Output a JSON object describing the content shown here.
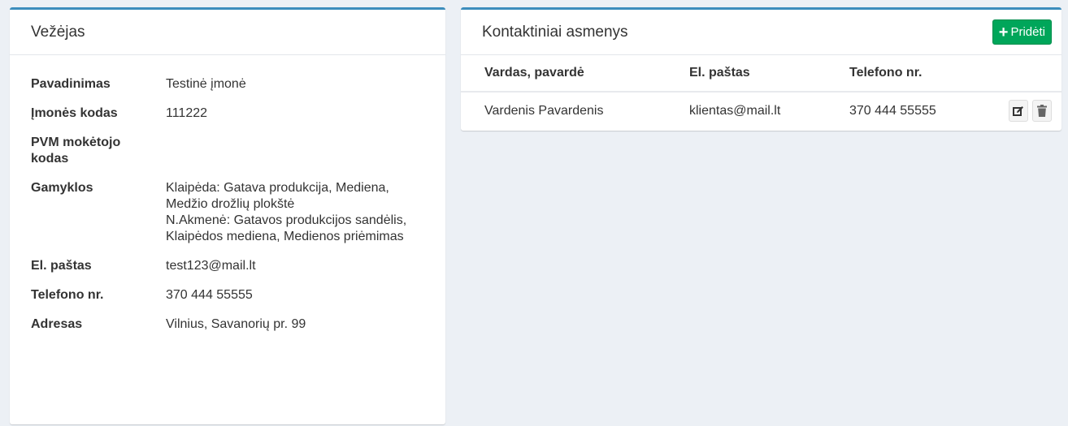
{
  "carrier": {
    "title": "Vežėjas",
    "fields": {
      "name_label": "Pavadinimas",
      "name_value": "Testinė įmonė",
      "code_label": "Įmonės kodas",
      "code_value": "111222",
      "vat_label": "PVM mokėtojo kodas",
      "vat_value": "",
      "factories_label": "Gamyklos",
      "factories_line1": "Klaipėda: Gatava produkcija, Mediena, Medžio drožlių plokštė",
      "factories_line2": "N.Akmenė: Gatavos produkcijos sandėlis, Klaipėdos mediena, Medienos priėmimas",
      "email_label": "El. paštas",
      "email_value": "test123@mail.lt",
      "phone_label": "Telefono nr.",
      "phone_value": "370 444 55555",
      "address_label": "Adresas",
      "address_value": "Vilnius, Savanorių pr. 99"
    }
  },
  "contacts": {
    "title": "Kontaktiniai asmenys",
    "add_label": "Pridėti",
    "columns": [
      "Vardas, pavardė",
      "El. paštas",
      "Telefono nr."
    ],
    "rows": [
      {
        "name": "Vardenis Pavardenis",
        "email": "klientas@mail.lt",
        "phone": "370 444 55555"
      }
    ]
  },
  "icons": {
    "add": "plus-icon",
    "edit": "edit-icon",
    "delete": "trash-icon"
  },
  "colors": {
    "accent": "#3c8dbc",
    "success": "#00a65a",
    "background": "#ecf0f5"
  }
}
